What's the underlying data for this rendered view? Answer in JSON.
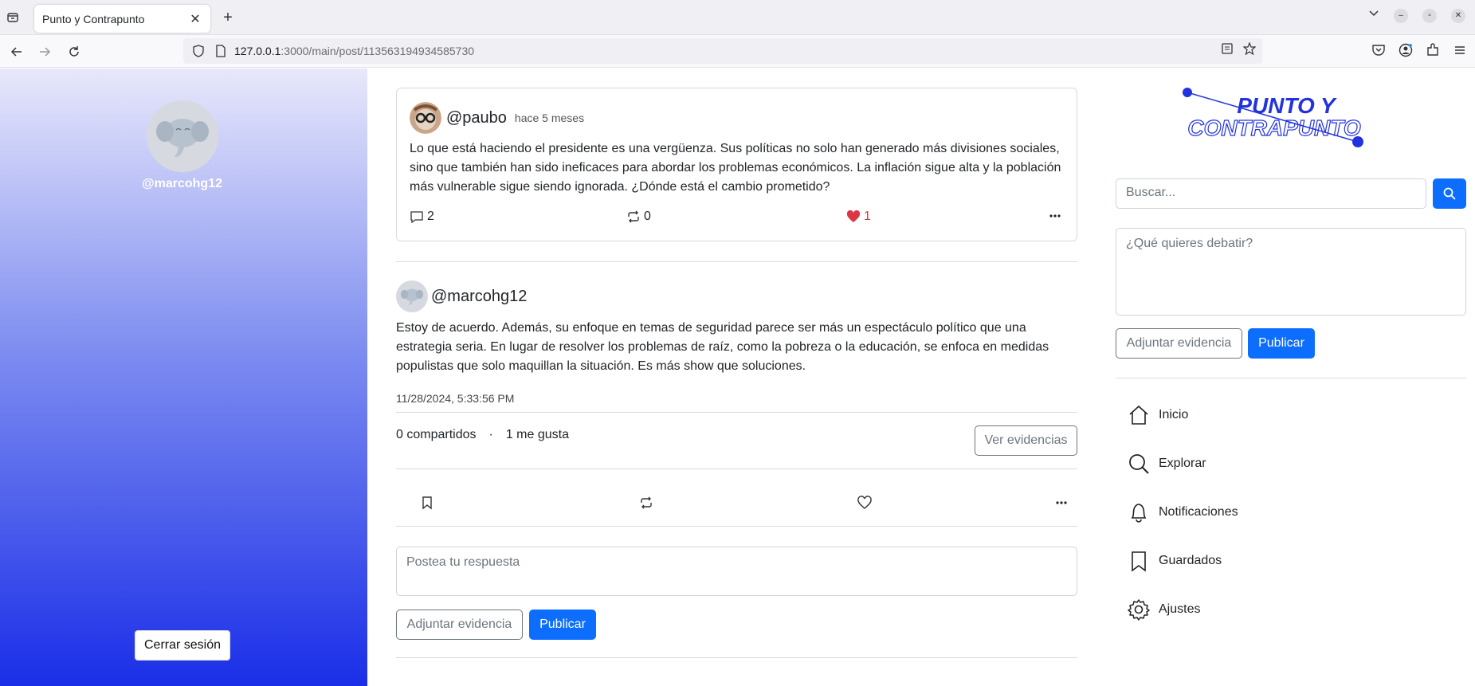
{
  "browser": {
    "tab_title": "Punto y Contrapunto",
    "url_host": "127.0.0.1",
    "url_rest": ":3000/main/post/113563194934585730"
  },
  "sidebar": {
    "username": "@marcohg12",
    "logout_label": "Cerrar sesión"
  },
  "post": {
    "handle": "@paubo",
    "time_ago": "hace 5 meses",
    "body": "Lo que está haciendo el presidente es una vergüenza. Sus políticas no solo han generado más divisiones sociales, sino que también han sido ineficaces para abordar los problemas económicos. La inflación sigue alta y la población más vulnerable sigue siendo ignorada. ¿Dónde está el cambio prometido?",
    "comments": "2",
    "reposts": "0",
    "likes": "1"
  },
  "reply": {
    "handle": "@marcohg12",
    "body": "Estoy de acuerdo. Además, su enfoque en temas de seguridad parece ser más un espectáculo político que una estrategia seria. En lugar de resolver los problemas de raíz, como la pobreza o la educación, se enfoca en medidas populistas que solo maquillan la situación. Es más show que soluciones.",
    "date": "11/28/2024, 5:33:56 PM",
    "shares": "0 compartidos",
    "separator": "·",
    "likes": "1 me gusta",
    "evidence_button": "Ver evidencias",
    "reply_placeholder": "Postea tu respuesta",
    "attach_label": "Adjuntar evidencia",
    "publish_label": "Publicar"
  },
  "right": {
    "logo_line1": "PUNTO Y",
    "logo_line2": "CONTRAPUNTO",
    "search_placeholder": "Buscar...",
    "debate_placeholder": "¿Qué quieres debatir?",
    "attach_label": "Adjuntar evidencia",
    "publish_label": "Publicar",
    "nav": [
      {
        "label": "Inicio",
        "icon": "home-icon"
      },
      {
        "label": "Explorar",
        "icon": "search-icon"
      },
      {
        "label": "Notificaciones",
        "icon": "bell-icon"
      },
      {
        "label": "Guardados",
        "icon": "bookmark-icon"
      },
      {
        "label": "Ajustes",
        "icon": "gear-icon"
      }
    ]
  },
  "colors": {
    "primary": "#0d6efd",
    "like": "#dc3545",
    "sidebar_top": "#e8e8fb",
    "sidebar_bottom": "#1a2ee8"
  }
}
